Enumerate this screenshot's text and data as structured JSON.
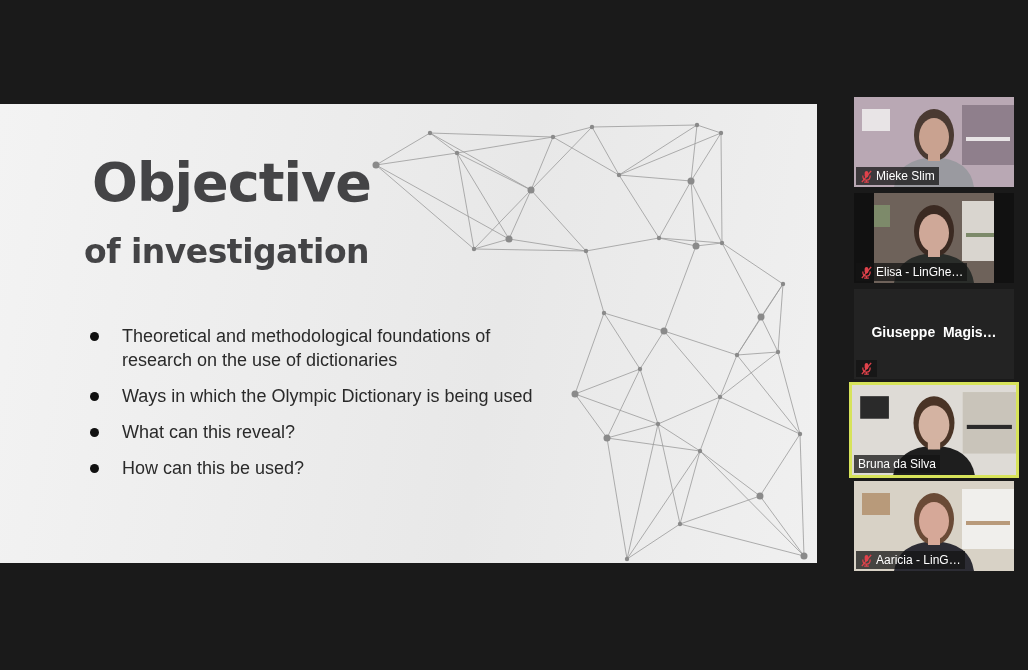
{
  "slide": {
    "title": "Objective",
    "subtitle": "of investigation",
    "bullets": [
      "Theoretical and methodological foundations of research on the use of dictionaries",
      "Ways in which the Olympic Dictionary is being used",
      "What can this reveal?",
      "How can this be used?"
    ]
  },
  "participants": [
    {
      "name": "Mieke Slim",
      "muted": true,
      "active": false,
      "video": true,
      "letterboxed": false
    },
    {
      "name": "Elisa - LinGhe…",
      "muted": true,
      "active": false,
      "video": true,
      "letterboxed": true
    },
    {
      "name": "Giuseppe  Magis…",
      "muted": true,
      "active": false,
      "video": false
    },
    {
      "name": "Bruna da Silva",
      "muted": false,
      "active": true,
      "video": true,
      "letterboxed": false
    },
    {
      "name": "Aaricia - LinG…",
      "muted": true,
      "active": false,
      "video": true,
      "letterboxed": false
    }
  ]
}
